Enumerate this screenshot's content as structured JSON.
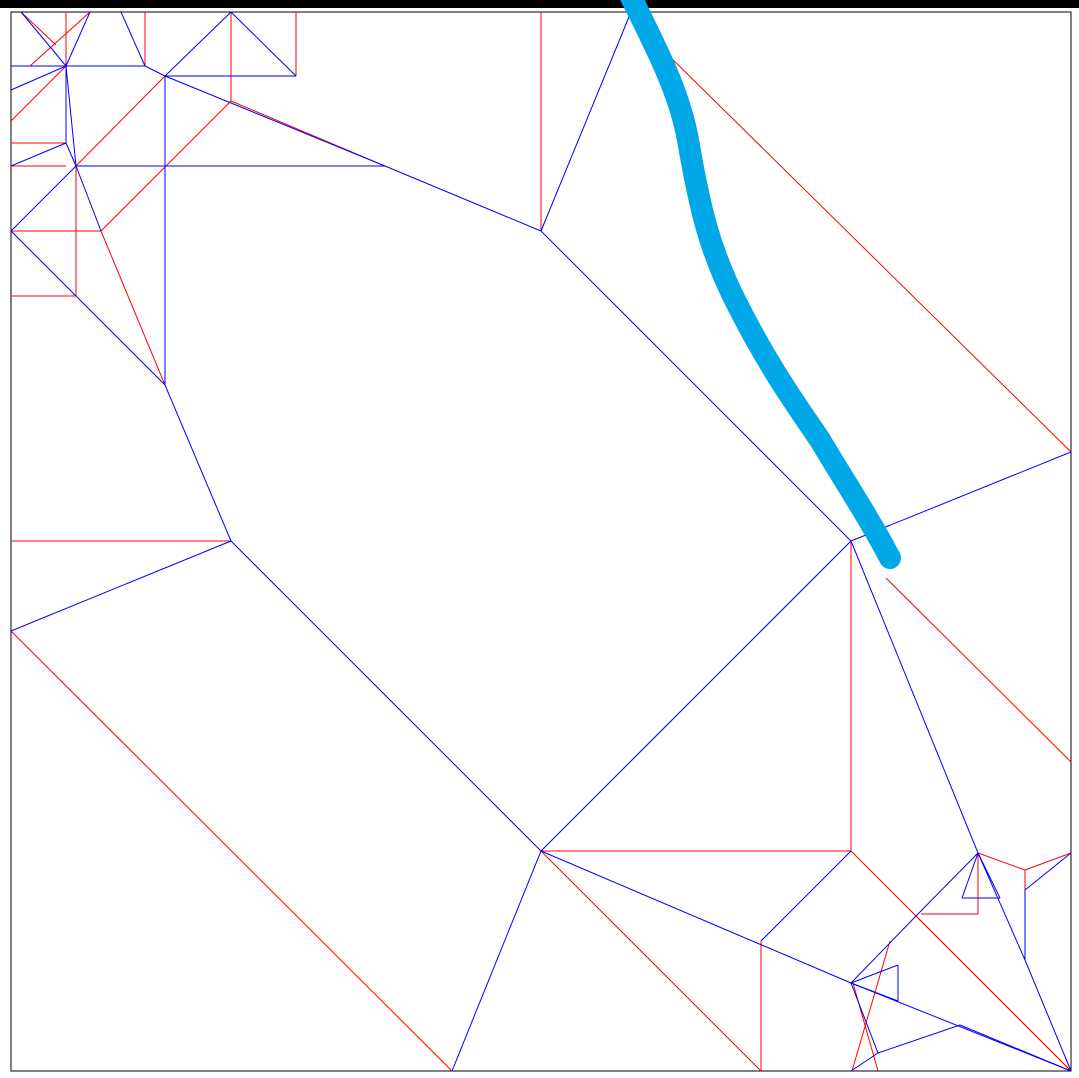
{
  "colors": {
    "page_background": "#ffffff",
    "top_bar": "#000000",
    "border": "#000000",
    "valley_fold": "#ff0000",
    "mountain_fold": "#0000ff",
    "pen_stroke": "#00a8e8"
  },
  "crease_pattern": {
    "line_types": [
      "valley",
      "mountain"
    ],
    "has_freehand_stroke": true
  }
}
